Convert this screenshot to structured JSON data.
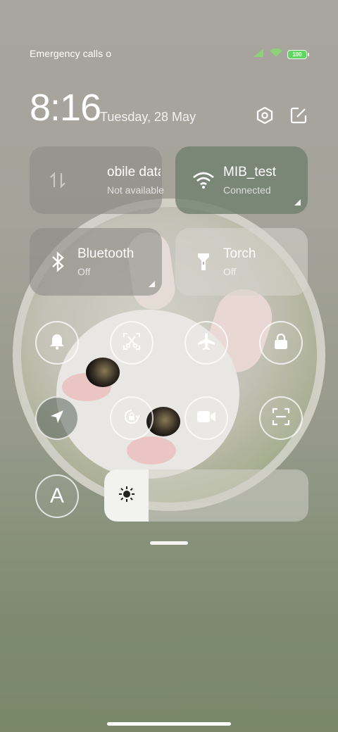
{
  "status_bar": {
    "carrier_text": "Emergency calls o",
    "battery_level": "100"
  },
  "header": {
    "time": "8:16",
    "date": "Tuesday, 28 May"
  },
  "tiles": [
    {
      "name": "obile data",
      "state": "Not available",
      "icon": "mobile-data-icon",
      "active": false
    },
    {
      "name": "MIB_test",
      "state": "Connected",
      "icon": "wifi-icon",
      "active": true
    },
    {
      "name": "Bluetooth",
      "state": "Off",
      "icon": "bluetooth-icon",
      "active": false
    },
    {
      "name": "Torch",
      "state": "Off",
      "icon": "torch-icon",
      "active": false
    }
  ],
  "toggles_row1": [
    "bell-icon",
    "screenshot-icon",
    "airplane-icon",
    "lock-icon"
  ],
  "toggles_row2": [
    "location-icon",
    "rotation-lock-icon",
    "video-icon",
    "scan-icon"
  ],
  "auto_brightness_label": "A",
  "brightness": {
    "level": 0.15,
    "icon": "sun-icon"
  },
  "colors": {
    "tile_active": "#6e7d6c",
    "battery": "#5fd65f",
    "wifi_signal": "#7fd66a"
  }
}
